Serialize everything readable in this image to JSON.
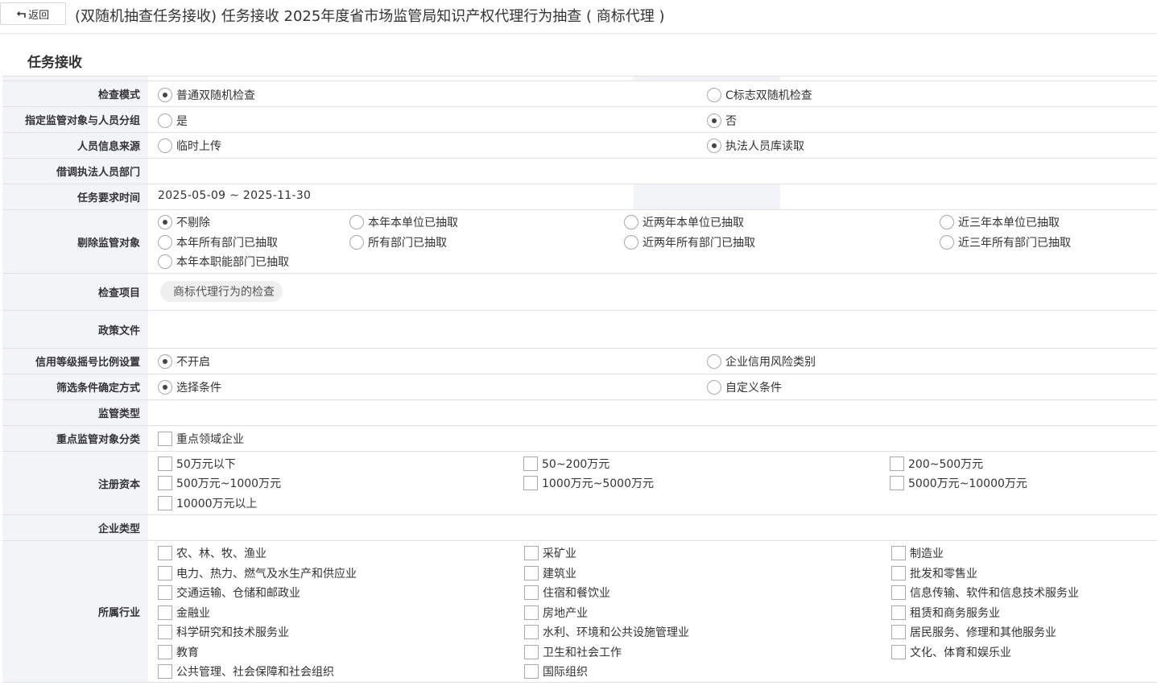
{
  "header": {
    "back_label": "返回",
    "title": "(双随机抽查任务接收) 任务接收 2025年度省市场监管局知识产权代理行为抽查 ( 商标代理 )"
  },
  "section_title": "任务接收",
  "form": {
    "check_mode": {
      "label": "检查模式",
      "options": [
        "普通双随机检查",
        "C标志双随机检查"
      ],
      "selected": 0
    },
    "assign_group": {
      "label": "指定监管对象与人员分组",
      "options": [
        "是",
        "否"
      ],
      "selected": 1
    },
    "personnel_source": {
      "label": "人员信息来源",
      "options": [
        "临时上传",
        "执法人员库读取"
      ],
      "selected": 1
    },
    "borrowed_dept": {
      "label": "借调执法人员部门",
      "value": ""
    },
    "task_time": {
      "label": "任务要求时间",
      "value": "2025-05-09 ~ 2025-11-30"
    },
    "exclude_objects": {
      "label": "剔除监管对象",
      "options": [
        "不剔除",
        "本年本单位已抽取",
        "近两年本单位已抽取",
        "近三年本单位已抽取",
        "本年所有部门已抽取",
        "所有部门已抽取",
        "近两年所有部门已抽取",
        "近三年所有部门已抽取",
        "本年本职能部门已抽取"
      ],
      "selected": 0
    },
    "check_items": {
      "label": "检查项目",
      "tag": "商标代理行为的检查"
    },
    "policy_docs": {
      "label": "政策文件",
      "value": ""
    },
    "credit_ratio": {
      "label": "信用等级摇号比例设置",
      "options": [
        "不开启",
        "企业信用风险类别"
      ],
      "selected": 0
    },
    "filter_mode": {
      "label": "筛选条件确定方式",
      "options": [
        "选择条件",
        "自定义条件"
      ],
      "selected": 0
    },
    "supervision_type": {
      "label": "监管类型",
      "value": ""
    },
    "key_objects": {
      "label": "重点监管对象分类",
      "options": [
        "重点领域企业"
      ]
    },
    "registered_capital": {
      "label": "注册资本",
      "options": [
        "50万元以下",
        "50~200万元",
        "200~500万元",
        "500万元~1000万元",
        "1000万元~5000万元",
        "5000万元~10000万元",
        "10000万元以上"
      ]
    },
    "enterprise_type": {
      "label": "企业类型",
      "value": ""
    },
    "industry": {
      "label": "所属行业",
      "options": [
        "农、林、牧、渔业",
        "采矿业",
        "制造业",
        "电力、热力、燃气及水生产和供应业",
        "建筑业",
        "批发和零售业",
        "交通运输、仓储和邮政业",
        "住宿和餐饮业",
        "信息传输、软件和信息技术服务业",
        "金融业",
        "房地产业",
        "租赁和商务服务业",
        "科学研究和技术服务业",
        "水利、环境和公共设施管理业",
        "居民服务、修理和其他服务业",
        "教育",
        "卫生和社会工作",
        "文化、体育和娱乐业",
        "公共管理、社会保障和社会组织",
        "国际组织"
      ]
    }
  }
}
